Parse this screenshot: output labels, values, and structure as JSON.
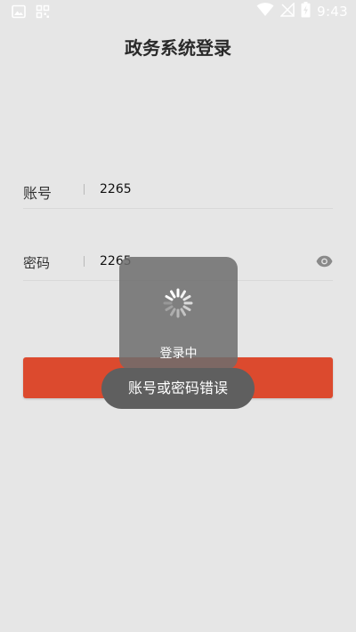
{
  "status_bar": {
    "time": "9:43",
    "left_icons": [
      "image-icon",
      "qr-grid-icon"
    ],
    "right_icons": [
      "wifi-icon",
      "no-signal-icon",
      "battery-charging-icon"
    ]
  },
  "page": {
    "title": "政务系统登录"
  },
  "form": {
    "account": {
      "label": "账号",
      "value": "2265"
    },
    "password": {
      "label": "密码",
      "value": "2265",
      "toggle_icon": "eye-icon"
    }
  },
  "login_button": {
    "label": ""
  },
  "loading": {
    "text": "登录中",
    "icon": "spinner-icon"
  },
  "toast": {
    "text": "账号或密码错误"
  },
  "colors": {
    "background": "#e6e6e6",
    "accent": "#dc4a2e",
    "overlay": "#6e6e6e",
    "toast": "#5f5f5f"
  }
}
